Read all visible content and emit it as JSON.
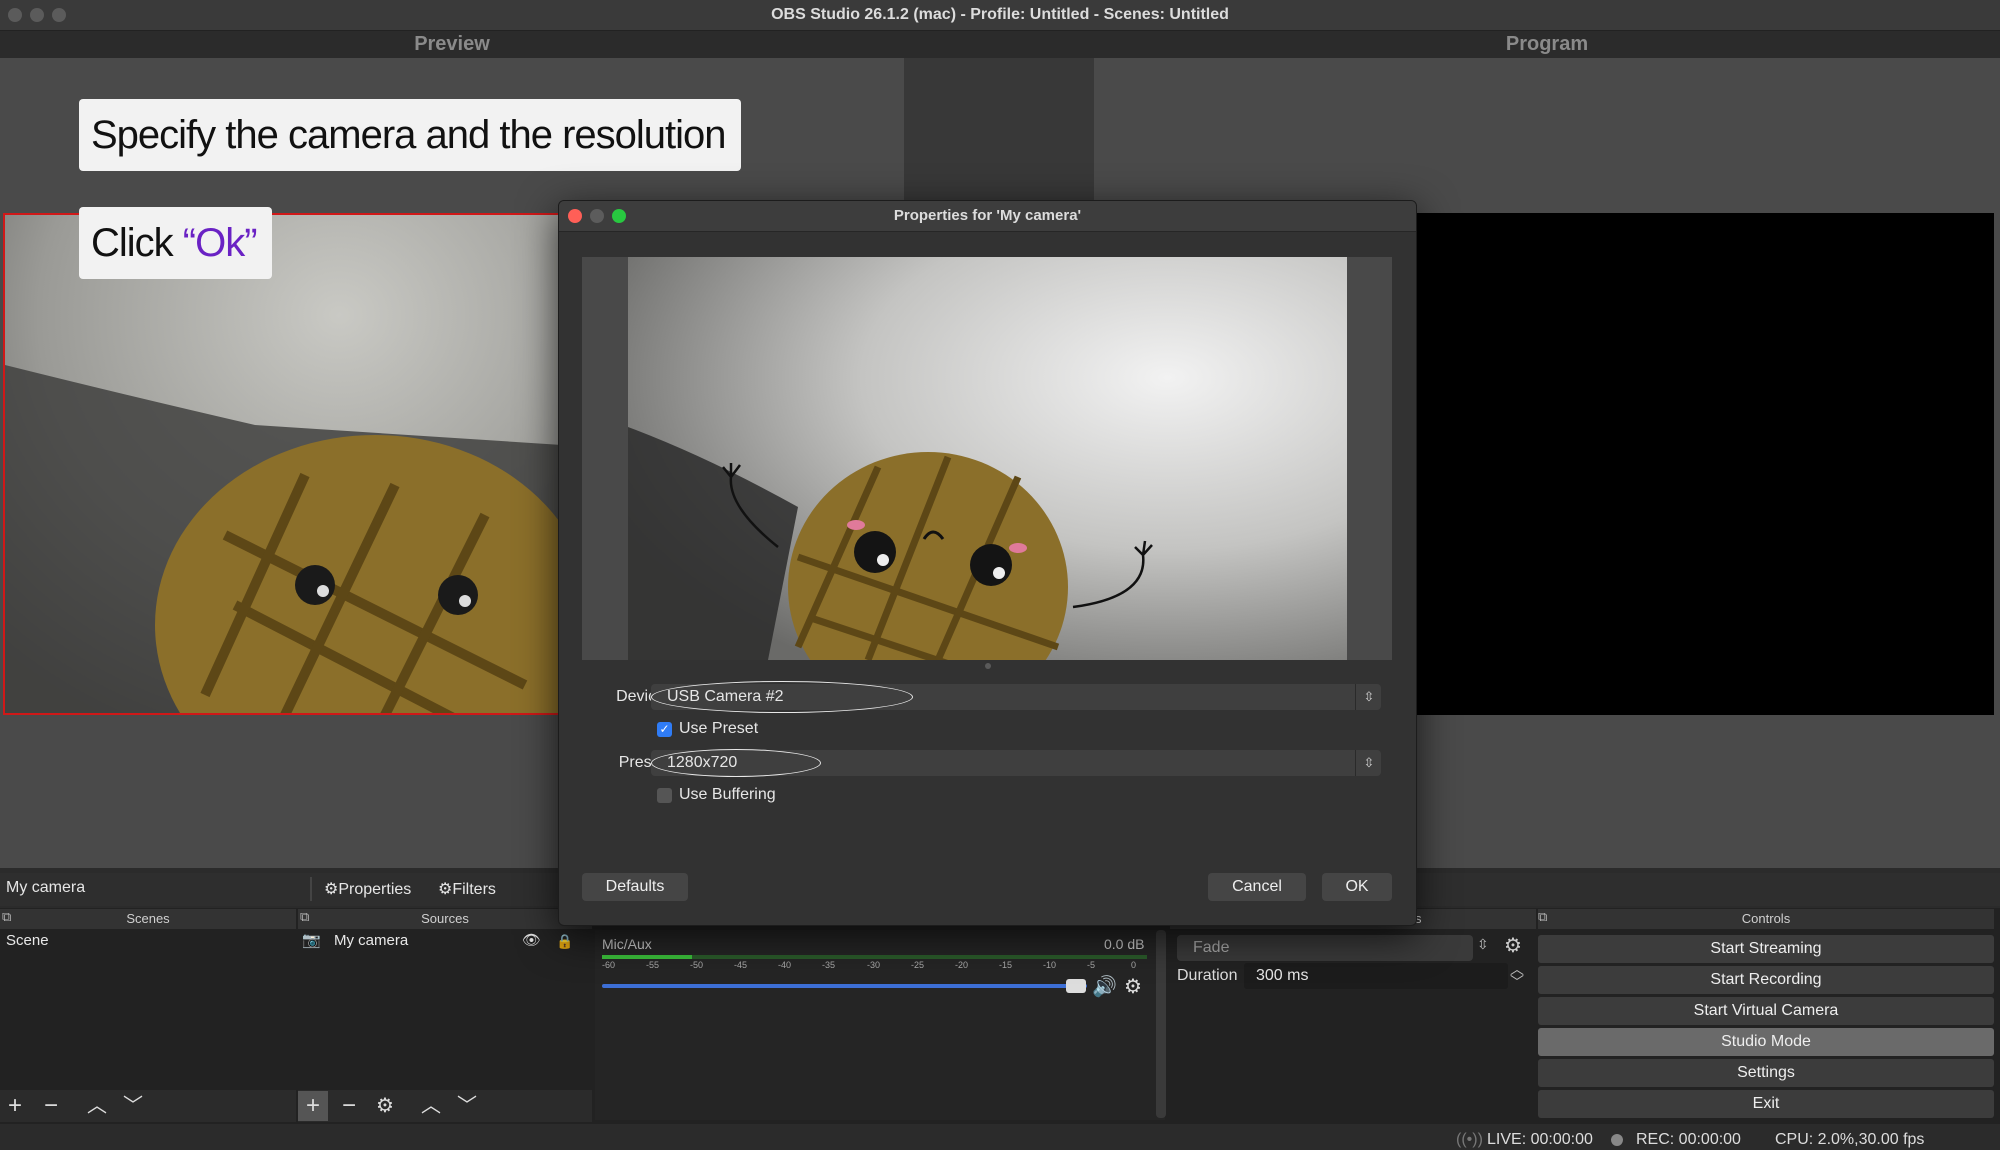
{
  "window": {
    "title": "OBS Studio 26.1.2 (mac) - Profile: Untitled - Scenes: Untitled"
  },
  "panes": {
    "preview_label": "Preview",
    "program_label": "Program"
  },
  "callouts": {
    "first": "Specify the camera and the resolution",
    "second_prefix": "Click ",
    "second_accent": "“Ok”"
  },
  "source_bar": {
    "name": "My camera",
    "properties_label": "Properties",
    "filters_label": "Filters"
  },
  "docks": {
    "scenes_title": "Scenes",
    "sources_title": "Sources",
    "controls_title": "Controls",
    "transitions_title_fragment": "s"
  },
  "scenes": {
    "items": [
      "Scene"
    ]
  },
  "sources": {
    "items": [
      {
        "name": "My camera",
        "visible": true,
        "locked": false
      }
    ]
  },
  "mixer": {
    "channel_name": "Mic/Aux",
    "level": "0.0 dB",
    "ticks": [
      "-60",
      "-55",
      "-50",
      "-45",
      "-40",
      "-35",
      "-30",
      "-25",
      "-20",
      "-15",
      "-10",
      "-5",
      "0"
    ],
    "volume_fraction": 0.94
  },
  "transitions": {
    "selected": "Fade",
    "duration_label": "Duration",
    "duration_value": "300 ms"
  },
  "controls": {
    "buttons": [
      "Start Streaming",
      "Start Recording",
      "Start Virtual Camera",
      "Studio Mode",
      "Settings",
      "Exit"
    ],
    "active": "Studio Mode"
  },
  "status": {
    "live": "LIVE: 00:00:00",
    "rec": "REC: 00:00:00",
    "cpu": "CPU: 2.0%,30.00 fps"
  },
  "dialog": {
    "title": "Properties for 'My camera'",
    "device_label": "Device",
    "device_value": "USB Camera #2",
    "use_preset_label": "Use Preset",
    "use_preset_checked": true,
    "preset_label": "Preset",
    "preset_value": "1280x720",
    "use_buffering_label": "Use Buffering",
    "use_buffering_checked": false,
    "defaults_label": "Defaults",
    "cancel_label": "Cancel",
    "ok_label": "OK"
  },
  "colors": {
    "accent_purple": "#6a22c4",
    "selection_red": "#d01818",
    "checkbox_blue": "#2f7cf6",
    "meter_green": "#3bbf3b",
    "volume_blue": "#3d6fd6"
  }
}
